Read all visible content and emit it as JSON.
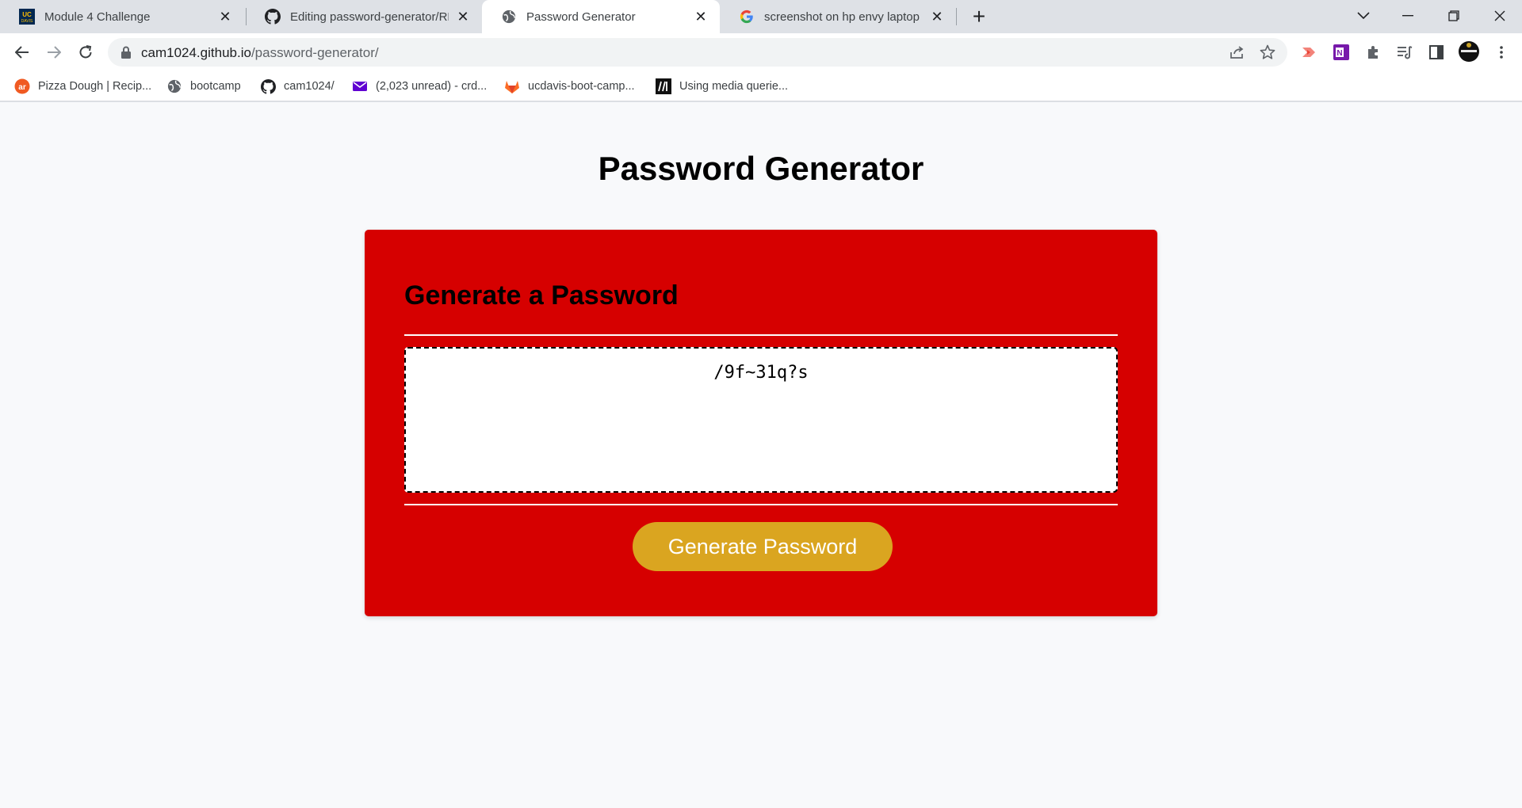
{
  "browser": {
    "tabs": [
      {
        "title": "Module 4 Challenge",
        "icon": "ucdavis-favicon",
        "active": false
      },
      {
        "title": "Editing password-generator/REA",
        "icon": "github-favicon",
        "active": false
      },
      {
        "title": "Password Generator",
        "icon": "globe-favicon",
        "active": true
      },
      {
        "title": "screenshot on hp envy laptop - G",
        "icon": "google-favicon",
        "active": false
      }
    ],
    "new_tab_label": "+",
    "url_host": "cam1024.github.io",
    "url_path": "/password-generator/"
  },
  "bookmarks": [
    {
      "label": "Pizza Dough | Recip...",
      "icon": "allrecipes-icon"
    },
    {
      "label": "bootcamp",
      "icon": "globe-icon"
    },
    {
      "label": "cam1024/",
      "icon": "github-icon"
    },
    {
      "label": "(2,023 unread) - crd...",
      "icon": "yahoo-mail-icon"
    },
    {
      "label": "ucdavis-boot-camp...",
      "icon": "gitlab-icon"
    },
    {
      "label": "Using media querie...",
      "icon": "mdn-icon"
    }
  ],
  "page": {
    "title": "Password Generator",
    "card_header": "Generate a Password",
    "password_value": "/9f~31q?s",
    "button_label": "Generate Password"
  },
  "colors": {
    "card_bg": "#d60000",
    "button_bg": "#daa520",
    "page_bg": "#f8f9fb"
  }
}
